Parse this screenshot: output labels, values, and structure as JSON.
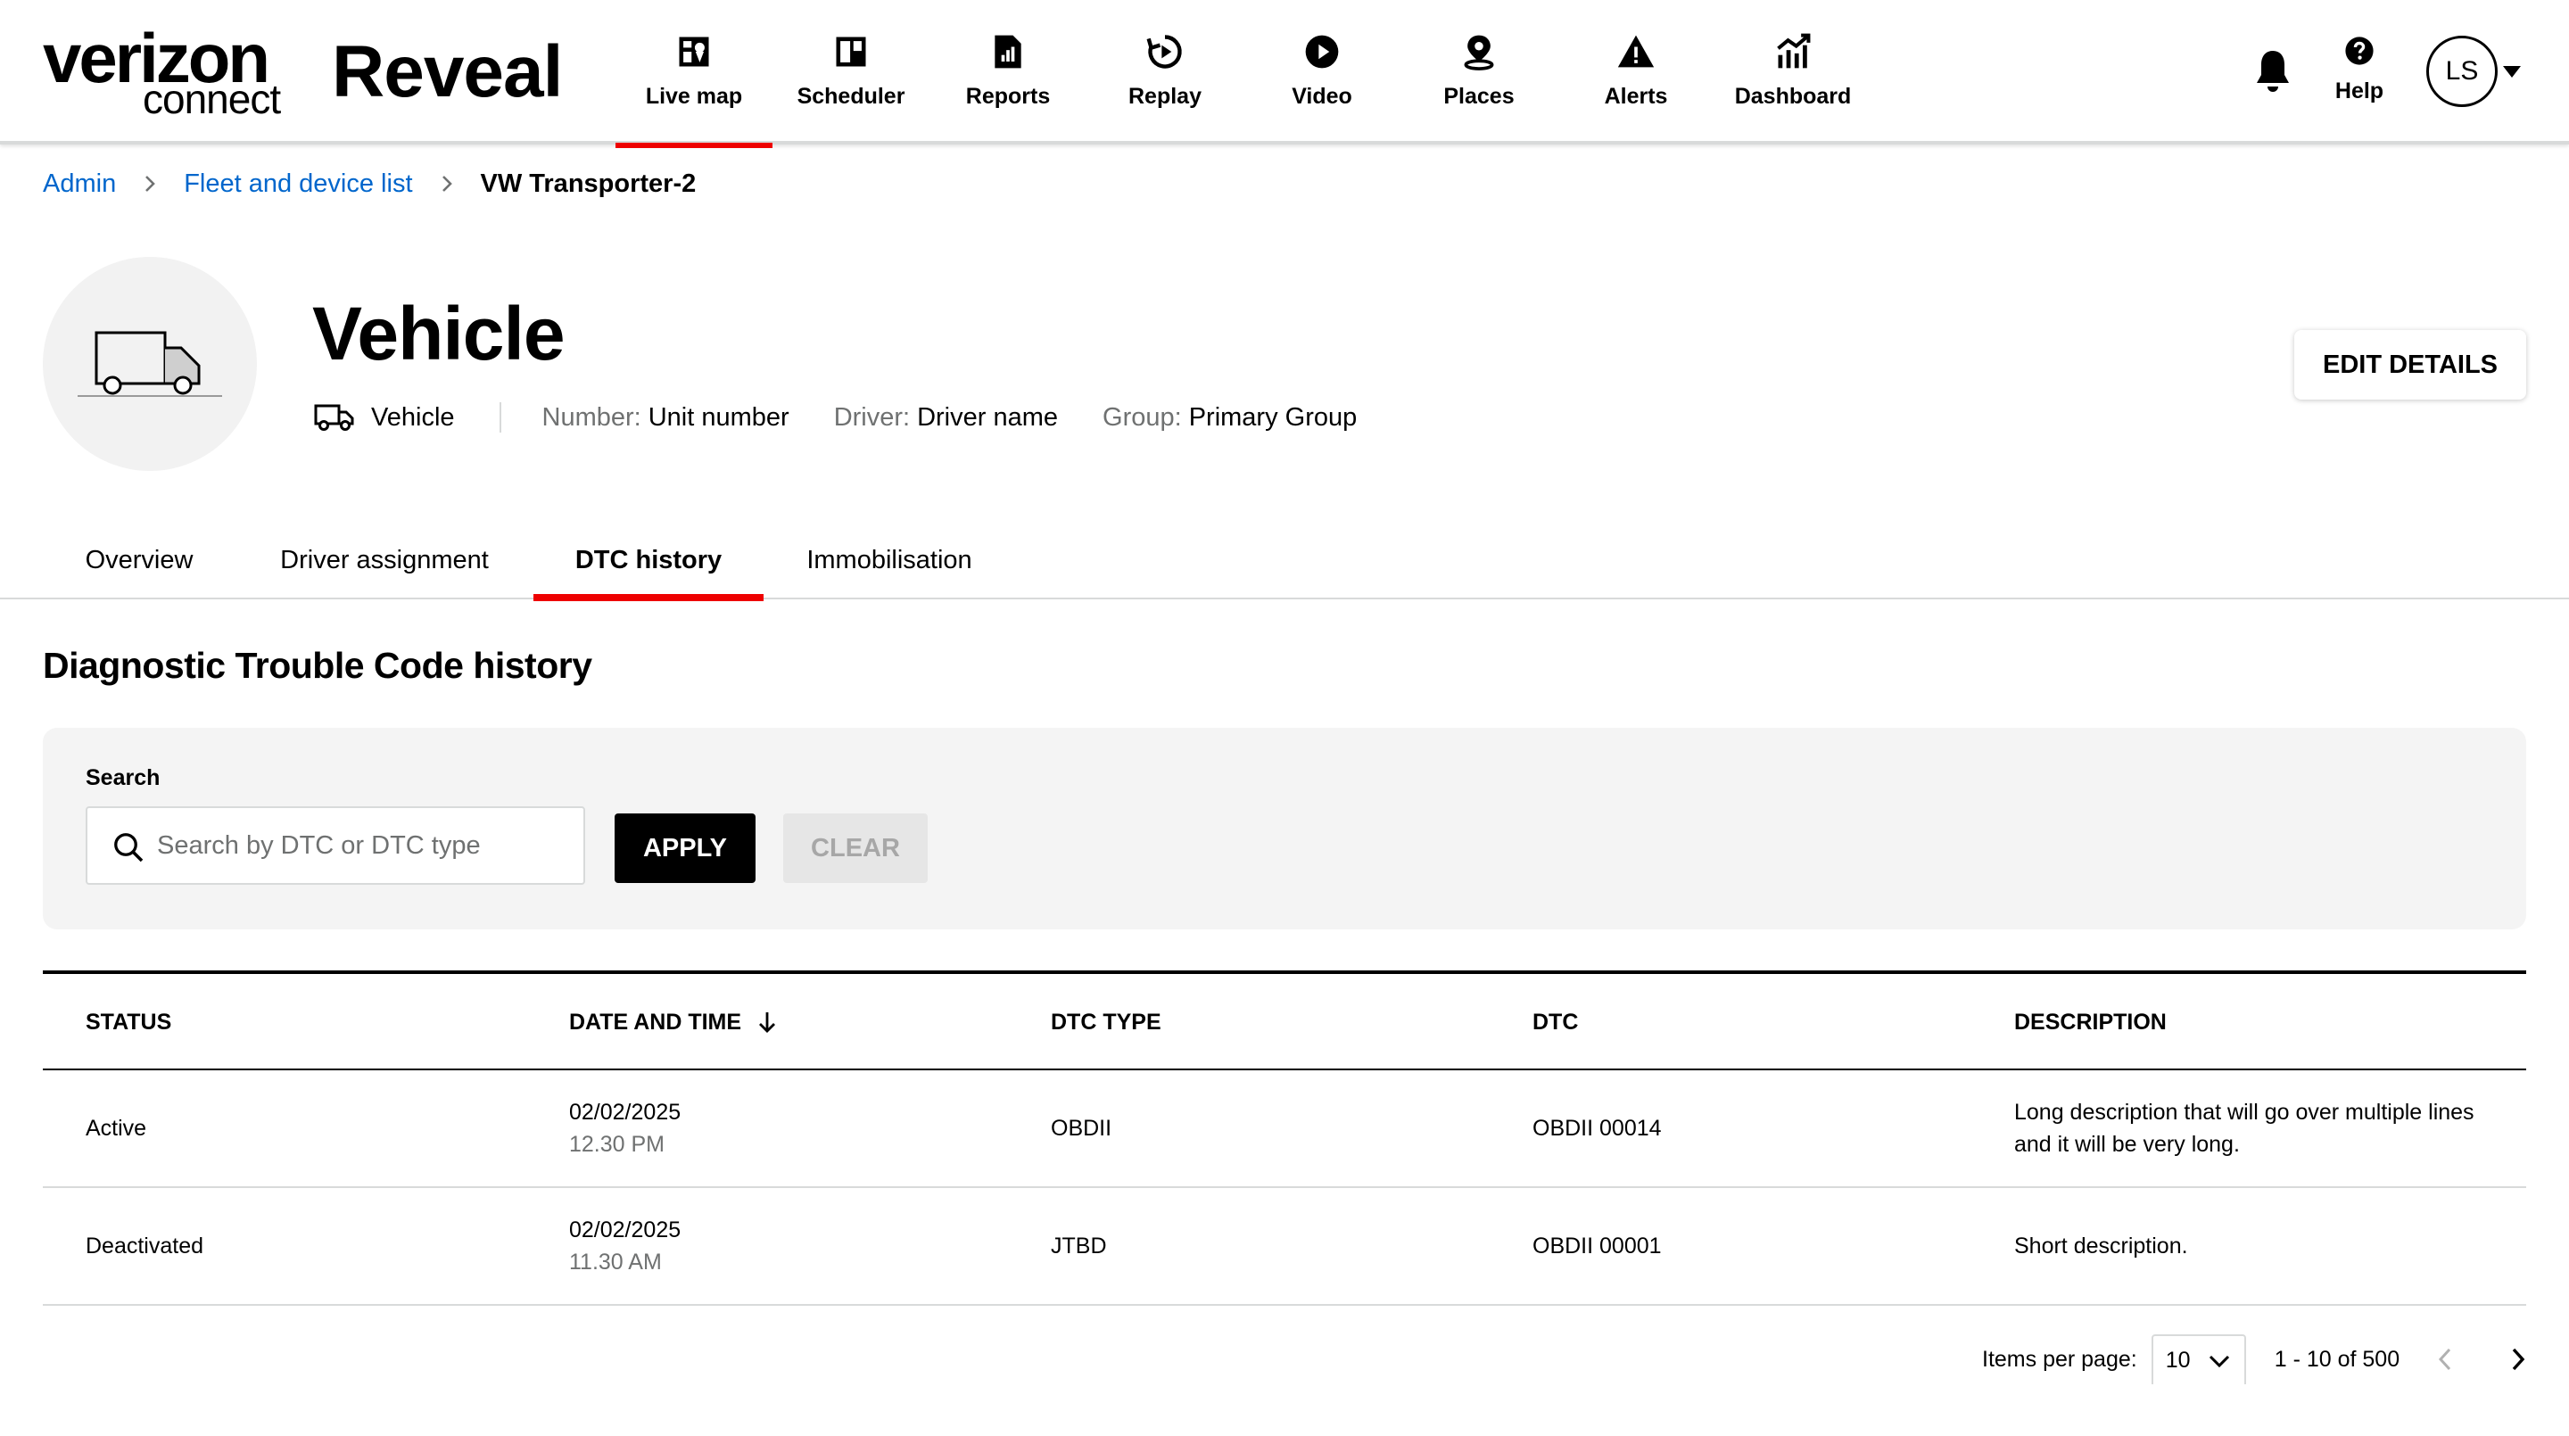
{
  "brand": {
    "line1": "verizon",
    "line2": "connect",
    "product": "Reveal"
  },
  "nav": {
    "items": [
      {
        "label": "Live map",
        "icon": "live-map-icon",
        "active": true
      },
      {
        "label": "Scheduler",
        "icon": "scheduler-icon"
      },
      {
        "label": "Reports",
        "icon": "reports-icon"
      },
      {
        "label": "Replay",
        "icon": "replay-icon"
      },
      {
        "label": "Video",
        "icon": "video-icon"
      },
      {
        "label": "Places",
        "icon": "places-icon"
      },
      {
        "label": "Alerts",
        "icon": "alerts-icon"
      },
      {
        "label": "Dashboard",
        "icon": "dashboard-icon"
      }
    ],
    "help_label": "Help",
    "user_initials": "LS",
    "accent_color": "#ee0000"
  },
  "breadcrumb": {
    "items": [
      "Admin",
      "Fleet and device list"
    ],
    "current": "VW Transporter-2"
  },
  "vehicle": {
    "title": "Vehicle",
    "type_label": "Vehicle",
    "number_key": "Number:",
    "number_value": "Unit number",
    "driver_key": "Driver:",
    "driver_value": "Driver name",
    "group_key": "Group:",
    "group_value": "Primary Group",
    "edit_label": "EDIT DETAILS"
  },
  "tabs": [
    {
      "label": "Overview"
    },
    {
      "label": "Driver assignment"
    },
    {
      "label": "DTC history",
      "active": true
    },
    {
      "label": "Immobilisation"
    }
  ],
  "section": {
    "title": "Diagnostic Trouble Code history"
  },
  "filter": {
    "label": "Search",
    "placeholder": "Search by DTC or DTC type",
    "value": "",
    "apply_label": "APPLY",
    "clear_label": "CLEAR"
  },
  "table": {
    "columns": [
      "STATUS",
      "DATE AND TIME",
      "DTC TYPE",
      "DTC",
      "DESCRIPTION"
    ],
    "sort_column": "DATE AND TIME",
    "sort_direction": "descending",
    "rows": [
      {
        "status": "Active",
        "date": "02/02/2025",
        "time": "12.30 PM",
        "dtc_type": "OBDII",
        "dtc": "OBDII 00014",
        "description": "Long description that will go over multiple lines and it will be very long."
      },
      {
        "status": "Deactivated",
        "date": "02/02/2025",
        "time": "11.30 AM",
        "dtc_type": "JTBD",
        "dtc": "OBDII 00001",
        "description": "Short description."
      }
    ]
  },
  "pagination": {
    "items_per_page_label": "Items per page:",
    "items_per_page": "10",
    "range": "1 - 10 of 500"
  }
}
